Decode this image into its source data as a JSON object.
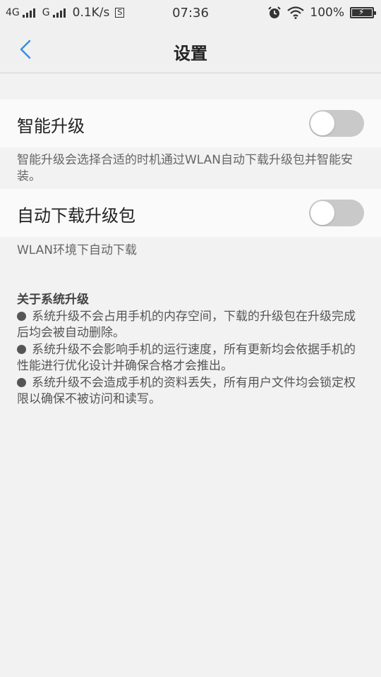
{
  "status_bar": {
    "network1": "4G",
    "network2": "G",
    "speed": "0.1K/s",
    "s_badge": "S",
    "time": "07:36",
    "alarm_icon": "alarm-clock-icon",
    "wifi_icon": "wifi-icon",
    "battery": "100%"
  },
  "nav": {
    "title": "设置",
    "back_icon": "chevron-left-icon",
    "accent": "#3a8ee6"
  },
  "settings": [
    {
      "label": "智能升级",
      "enabled": false,
      "desc": "智能升级会选择合适的时机通过WLAN自动下载升级包并智能安装。"
    },
    {
      "label": "自动下载升级包",
      "enabled": false,
      "desc": "WLAN环境下自动下载"
    }
  ],
  "about": {
    "title": "关于系统升级",
    "items": [
      "系统升级不会占用手机的内存空间，下载的升级包在升级完成后均会被自动删除。",
      "系统升级不会影响手机的运行速度，所有更新均会依据手机的性能进行优化设计并确保合格才会推出。",
      "系统升级不会造成手机的资料丢失，所有用户文件均会锁定权限以确保不被访问和读写。"
    ]
  }
}
